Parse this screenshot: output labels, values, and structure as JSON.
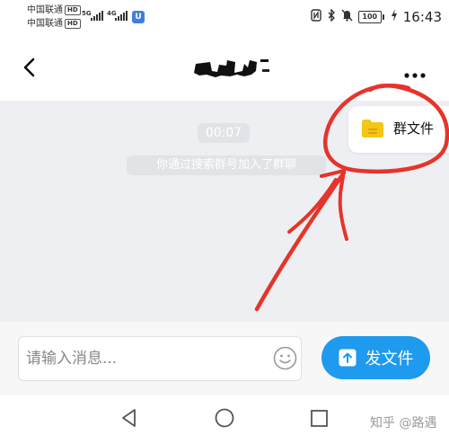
{
  "status_bar": {
    "carrier_1": "中国联通",
    "carrier_2": "中国联通",
    "hd_badge": "HD",
    "net_1": "5G",
    "net_2": "4G",
    "battery": "100",
    "time": "16:43",
    "icons": [
      "nfc-icon",
      "bluetooth-icon",
      "mute-icon",
      "charging-icon"
    ]
  },
  "header": {
    "title": "",
    "back_icon": "chevron-left-icon",
    "more_icon": "more-dots-icon"
  },
  "chat": {
    "timestamp": "00:07",
    "system_message": "你通过搜索群号加入了群聊",
    "group_files_label": "群文件",
    "group_files_icon": "folder-icon"
  },
  "input_bar": {
    "placeholder": "请输入消息...",
    "value": "",
    "emoji_icon": "smile-icon",
    "send_file_label": "发文件",
    "send_file_icon": "upload-icon"
  },
  "system_nav": {
    "back_icon": "triangle-back-icon",
    "home_icon": "circle-home-icon",
    "recent_icon": "square-recent-icon"
  },
  "watermark": "知乎 @路遇",
  "colors": {
    "accent": "#1e9aee",
    "chat_background": "#eeeff2",
    "annotation": "#e6342a",
    "folder": "#f5c518"
  }
}
